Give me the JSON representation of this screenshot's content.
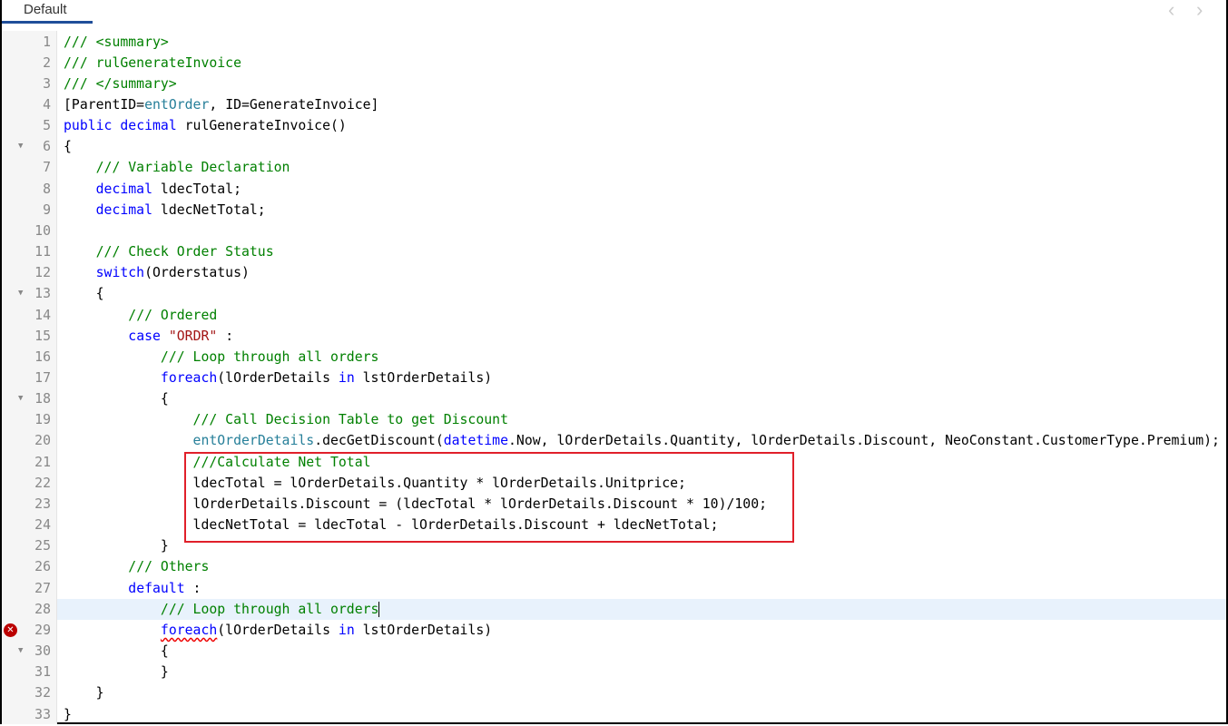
{
  "tabs": [
    {
      "label": "Default",
      "active": true
    }
  ],
  "nav": {
    "prev_icon": "‹",
    "next_icon": "›"
  },
  "colors": {
    "comment": "#008000",
    "keyword": "#0000ff",
    "type": "#267f99",
    "string": "#a31515",
    "highlight_box": "#e0202a",
    "active_line": "#e8f2fc"
  },
  "editor": {
    "active_line": 28,
    "error_line": 29,
    "fold_lines": [
      6,
      13,
      18,
      30
    ],
    "highlighted_range": [
      21,
      24
    ],
    "lines": [
      [
        [
          "/// <summary>",
          "comment"
        ]
      ],
      [
        [
          "/// rulGenerateInvoice",
          "comment"
        ]
      ],
      [
        [
          "/// </summary>",
          "comment"
        ]
      ],
      [
        [
          "[ParentID=",
          ""
        ],
        [
          "entOrder",
          "type"
        ],
        [
          ", ID=GenerateInvoice]",
          ""
        ]
      ],
      [
        [
          "public",
          "kw"
        ],
        [
          " ",
          ""
        ],
        [
          "decimal",
          "kw"
        ],
        [
          " rulGenerateInvoice()",
          ""
        ]
      ],
      [
        [
          "{",
          ""
        ]
      ],
      [
        [
          "    ",
          ""
        ],
        [
          "/// Variable Declaration",
          "comment"
        ]
      ],
      [
        [
          "    ",
          ""
        ],
        [
          "decimal",
          "kw"
        ],
        [
          " ldecTotal;",
          ""
        ]
      ],
      [
        [
          "    ",
          ""
        ],
        [
          "decimal",
          "kw"
        ],
        [
          " ldecNetTotal;",
          ""
        ]
      ],
      [],
      [
        [
          "    ",
          ""
        ],
        [
          "/// Check Order Status",
          "comment"
        ]
      ],
      [
        [
          "    ",
          ""
        ],
        [
          "switch",
          "kw"
        ],
        [
          "(Orderstatus)",
          ""
        ]
      ],
      [
        [
          "    {",
          ""
        ]
      ],
      [
        [
          "        ",
          ""
        ],
        [
          "/// Ordered",
          "comment"
        ]
      ],
      [
        [
          "        ",
          ""
        ],
        [
          "case",
          "kw"
        ],
        [
          " ",
          ""
        ],
        [
          "\"ORDR\"",
          "str"
        ],
        [
          " :",
          ""
        ]
      ],
      [
        [
          "            ",
          ""
        ],
        [
          "/// Loop through all orders",
          "comment"
        ]
      ],
      [
        [
          "            ",
          ""
        ],
        [
          "foreach",
          "kw"
        ],
        [
          "(lOrderDetails ",
          ""
        ],
        [
          "in",
          "kw"
        ],
        [
          " lstOrderDetails)",
          ""
        ]
      ],
      [
        [
          "            {",
          ""
        ]
      ],
      [
        [
          "                ",
          ""
        ],
        [
          "/// Call Decision Table to get Discount",
          "comment"
        ]
      ],
      [
        [
          "                ",
          ""
        ],
        [
          "entOrderDetails",
          "type"
        ],
        [
          ".decGetDiscount(",
          ""
        ],
        [
          "datetime",
          "kw"
        ],
        [
          ".Now, lOrderDetails.Quantity, lOrderDetails.Discount, NeoConstant.CustomerType.Premium);",
          ""
        ]
      ],
      [
        [
          "                ",
          ""
        ],
        [
          "///Calculate Net Total",
          "comment"
        ]
      ],
      [
        [
          "                ldecTotal = lOrderDetails.Quantity * lOrderDetails.Unitprice;",
          ""
        ]
      ],
      [
        [
          "                lOrderDetails.Discount = (ldecTotal * lOrderDetails.Discount * 10)/100;",
          ""
        ]
      ],
      [
        [
          "                ldecNetTotal = ldecTotal - lOrderDetails.Discount + ldecNetTotal;",
          ""
        ]
      ],
      [
        [
          "            }",
          ""
        ]
      ],
      [
        [
          "        ",
          ""
        ],
        [
          "/// Others",
          "comment"
        ]
      ],
      [
        [
          "        ",
          ""
        ],
        [
          "default",
          "kw"
        ],
        [
          " :",
          ""
        ]
      ],
      [
        [
          "            ",
          ""
        ],
        [
          "/// Loop through all orders",
          "comment"
        ]
      ],
      [
        [
          "            ",
          ""
        ],
        [
          "foreach",
          "squig"
        ],
        [
          "(lOrderDetails ",
          ""
        ],
        [
          "in",
          "kw"
        ],
        [
          " lstOrderDetails)",
          ""
        ]
      ],
      [
        [
          "            {",
          ""
        ]
      ],
      [
        [
          "            }",
          ""
        ]
      ],
      [
        [
          "    }",
          ""
        ]
      ],
      [
        [
          "}",
          ""
        ]
      ]
    ]
  }
}
